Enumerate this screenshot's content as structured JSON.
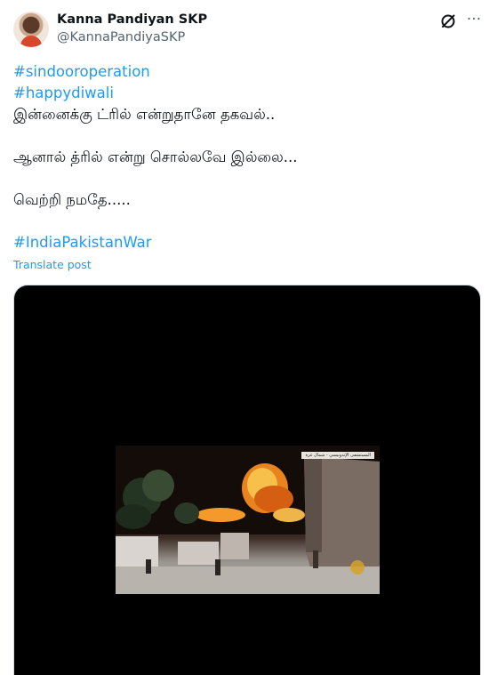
{
  "author": {
    "name": "Kanna Pandiyan SKP",
    "handle": "@KannaPandiyaSKP"
  },
  "header_icons": {
    "grok": "grok-icon",
    "more": "more-icon",
    "more_glyph": "···"
  },
  "tweet": {
    "hashtag_1": "#sindooroperation",
    "hashtag_2": "#happydiwali",
    "line_1": "இன்னைக்கு ட்ரில் என்றுதானே தகவல்..",
    "line_2": "ஆனால் த்ரில் என்று சொல்லவே இல்லை...",
    "line_3": "வெற்றி நமதே.....",
    "hashtag_3": "#IndiaPakistanWar"
  },
  "translate_label": "Translate post",
  "media": {
    "ticker_text": "المستشفى الإندونيسي - شمال غزة"
  },
  "colors": {
    "link": "#1d9bf0",
    "text": "#0f1419",
    "secondary": "#536471",
    "media_bg": "#000000"
  }
}
